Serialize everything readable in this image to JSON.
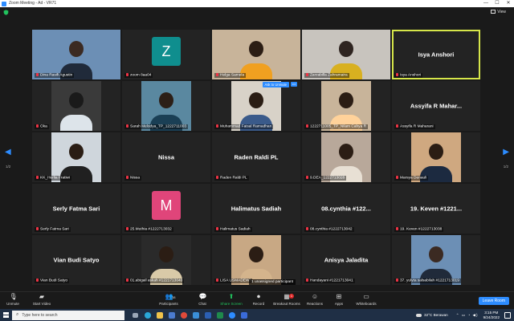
{
  "window": {
    "title": "Zoom Meeting - Ad - VR71",
    "minimize": "—",
    "maximize": "☐",
    "close": "✕"
  },
  "meeting": {
    "view_label": "View",
    "page_left": "1/2",
    "page_right": "1/2",
    "tooltip_unmute": "Ask to Unmute",
    "tooltip_more": "•••",
    "popup": "1 unassigned participant",
    "tiles": [
      {
        "name": "Dina Rasifi Agustin",
        "kind": "photo"
      },
      {
        "name": "zoom 8aa04",
        "kind": "avatar",
        "letter": "Z",
        "color": "#0f8e8e"
      },
      {
        "name": "Helga Samela",
        "kind": "photo"
      },
      {
        "name": "Zarzabilla Zahramaira",
        "kind": "photo"
      },
      {
        "name": "Isya Anshori",
        "kind": "name",
        "display": "Isya Anshori",
        "active": true
      },
      {
        "name": "Oka",
        "kind": "photo"
      },
      {
        "name": "Sarah Melodya_TP_1222711003",
        "kind": "photo"
      },
      {
        "name": "Muhammad Faisal Ramadhan",
        "kind": "photo"
      },
      {
        "name": "1222711005_TP_Nilam Cahya R",
        "kind": "photo"
      },
      {
        "name": "Assyifa R Maharani",
        "kind": "name",
        "display": "Assyifa R Mahar..."
      },
      {
        "name": "KK_Herlia Fratiwi",
        "kind": "photo"
      },
      {
        "name": "Nissa",
        "kind": "name",
        "display": "Nissa"
      },
      {
        "name": "Raden Raldi PL",
        "kind": "name",
        "display": "Raden Raldi PL"
      },
      {
        "name": "9.DEA_1222713028",
        "kind": "photo"
      },
      {
        "name": "Marsya Denauli",
        "kind": "photo"
      },
      {
        "name": "Serly Fatma Sari",
        "kind": "name",
        "display": "Serly Fatma Sari"
      },
      {
        "name": "25.Muthia #1222713032",
        "kind": "avatar",
        "letter": "M",
        "color": "#e0457a"
      },
      {
        "name": "Halimatus Sadiah",
        "kind": "name",
        "display": "Halimatus Sadiah"
      },
      {
        "name": "08.cynthia #1222713042",
        "kind": "name",
        "display": "08.cynthia #122..."
      },
      {
        "name": "19. Keven #1222713038",
        "kind": "name",
        "display": "19. Keven #1221..."
      },
      {
        "name": "Vian Budi Satyo",
        "kind": "name",
        "display": "Vian Budi Satyo"
      },
      {
        "name": "01.abigail askah #1221713040",
        "kind": "photo"
      },
      {
        "name": "LISA USMADEWI",
        "kind": "photo"
      },
      {
        "name": "Anisya Jaladita",
        "kind": "name",
        "display": "Anisya Jaladita",
        "label": "Handayani #1221713041"
      },
      {
        "name": "37. yulyta salsabilah #1221713019",
        "kind": "photo"
      }
    ]
  },
  "toolbar": {
    "unmute": "Unmute",
    "start_video": "Start Video",
    "participants": "Participants",
    "participants_count": "38",
    "chat": "Chat",
    "share_screen": "Share Screen",
    "record": "Record",
    "breakout_rooms": "Breakout Rooms",
    "reactions": "Reactions",
    "apps": "Apps",
    "whiteboards": "Whiteboards",
    "leave": "Leave Room",
    "chat_badge": "1"
  },
  "taskbar": {
    "search_placeholder": "Type here to search",
    "temperature": "32°C",
    "weather": "Berawan",
    "time": "3:15 PM",
    "date": "9/24/2022"
  },
  "colors": {
    "accent": "#2d8cff",
    "share": "#22c35e",
    "active_border": "#d6e64a",
    "leave": "#2d8cff"
  }
}
